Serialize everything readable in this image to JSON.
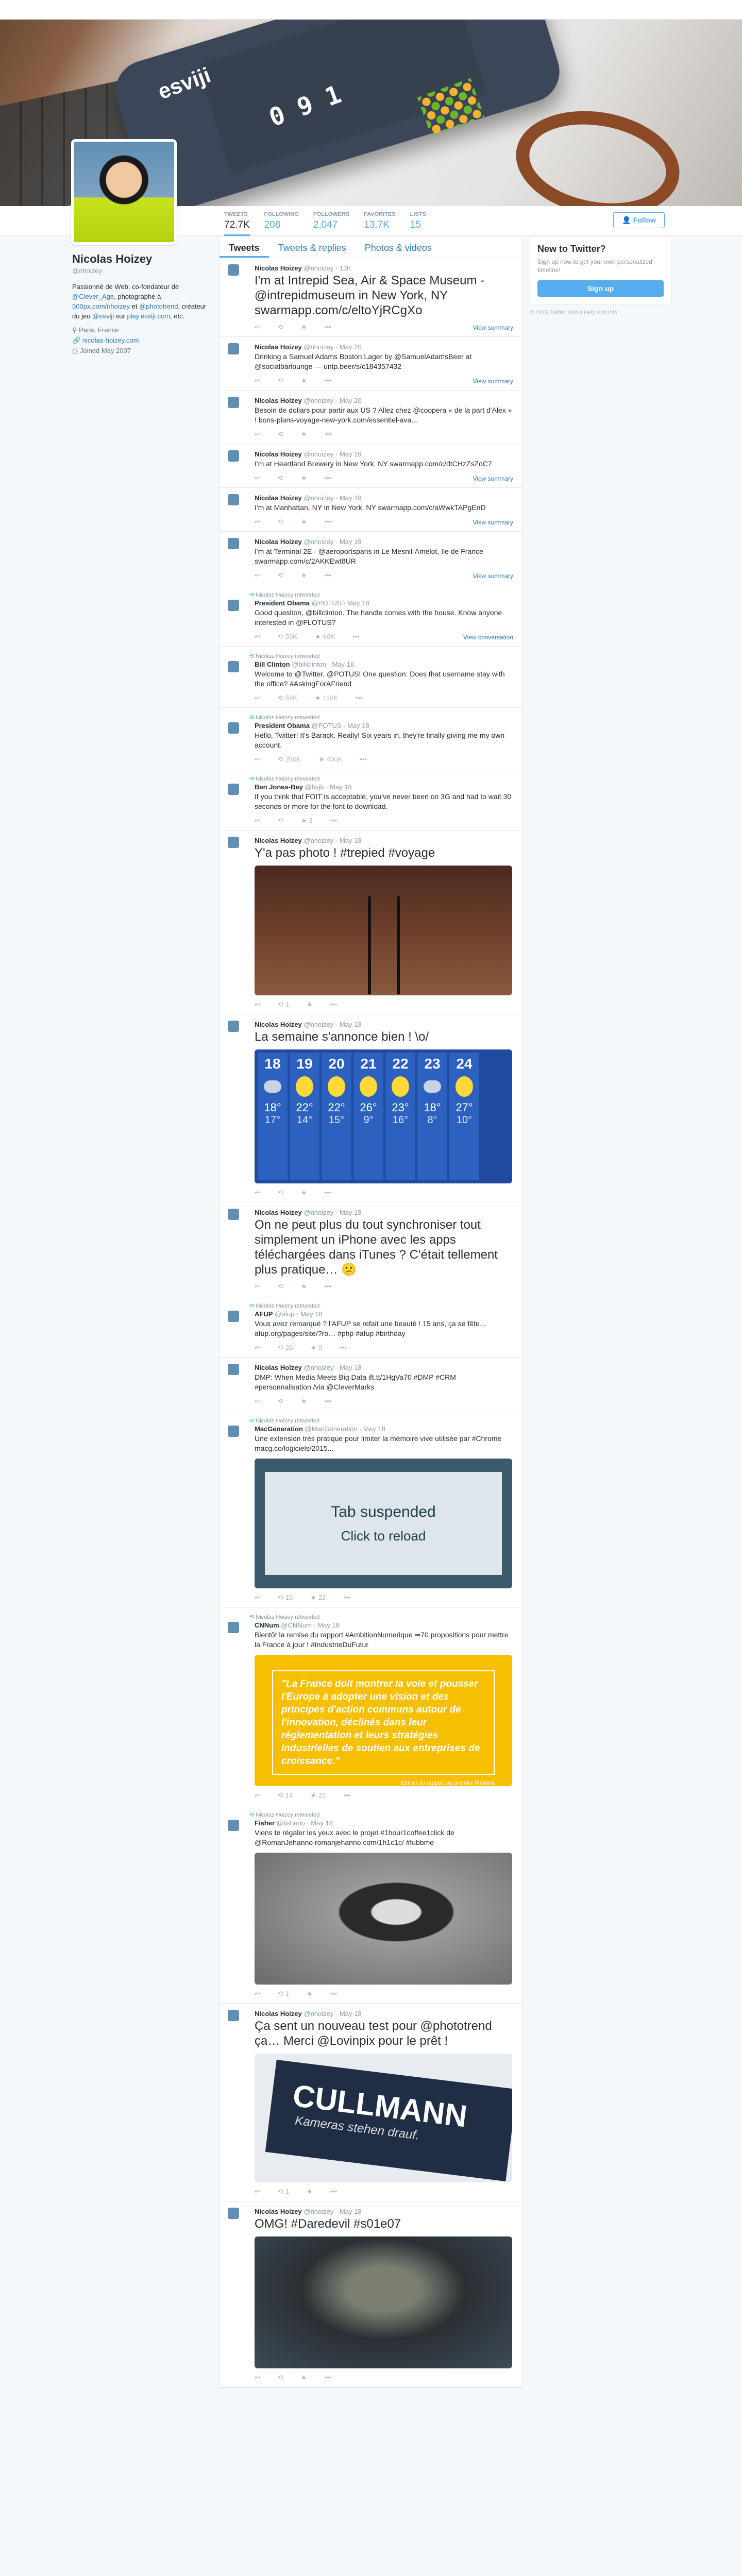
{
  "profile": {
    "name": "Nicolas Hoizey",
    "handle": "@nhoizey",
    "bio_parts": [
      "Passionné de Web, co-fondateur de ",
      "@Clever_Age",
      ", photographe à ",
      "500px.com/nhoizey",
      " et ",
      "@phototrend",
      ", créateur du jeu ",
      "@esviji",
      " sur ",
      "play.esviji.com",
      ", etc."
    ],
    "location": "Paris, France",
    "website": "nicolas-hoizey.com",
    "joined": "Joined May 2007"
  },
  "stats": [
    {
      "label": "Tweets",
      "value": "72.7K"
    },
    {
      "label": "Following",
      "value": "208"
    },
    {
      "label": "Followers",
      "value": "2,047"
    },
    {
      "label": "Favorites",
      "value": "13.7K"
    },
    {
      "label": "Lists",
      "value": "15"
    }
  ],
  "follow_label": "Follow",
  "tabs": [
    "Tweets",
    "Tweets & replies",
    "Photos & videos"
  ],
  "sidebar": {
    "title": "New to Twitter?",
    "text": "Sign up now to get your own personalized timeline!",
    "button": "Sign up",
    "footer": "© 2015 Twitter  About  Help  Ads info"
  },
  "tweets": [
    {
      "retweet": "",
      "name": "Nicolas Hoizey",
      "handle": "@nhoizey · 13h",
      "text": "I'm at Intrepid Sea, Air & Space Museum - @intrepidmuseum in New York, NY swarmapp.com/c/eltoYjRCgXo",
      "big": true,
      "summary": "View summary",
      "counts": [
        "",
        "",
        ""
      ]
    },
    {
      "retweet": "",
      "name": "Nicolas Hoizey",
      "handle": "@nhoizey · May 20",
      "text": "Drinking a Samuel Adams Boston Lager by @SamuelAdamsBeer at @socialbarlounge — untp.beer/s/c184357432",
      "big": false,
      "summary": "View summary",
      "counts": [
        "",
        "",
        ""
      ]
    },
    {
      "retweet": "",
      "name": "Nicolas Hoizey",
      "handle": "@nhoizey · May 20",
      "text": "Besoin de dollars pour partir aux US ? Allez chez @coopera « de la part d'Alex » ! bons-plans-voyage-new-york.com/essentiel-ava...",
      "big": false,
      "summary": "",
      "counts": [
        "",
        "",
        ""
      ]
    },
    {
      "retweet": "",
      "name": "Nicolas Hoizey",
      "handle": "@nhoizey · May 19",
      "text": "I'm at Heartland Brewery in New York, NY swarmapp.com/c/dtCHzZsZoC7",
      "big": false,
      "summary": "View summary",
      "counts": [
        "",
        "",
        ""
      ]
    },
    {
      "retweet": "",
      "name": "Nicolas Hoizey",
      "handle": "@nhoizey · May 19",
      "text": "I'm at Manhattan, NY in New York, NY swarmapp.com/c/aWwkTAPgEnD",
      "big": false,
      "summary": "View summary",
      "counts": [
        "",
        "",
        ""
      ]
    },
    {
      "retweet": "",
      "name": "Nicolas Hoizey",
      "handle": "@nhoizey · May 19",
      "text": "I'm at Terminal 2E - @aeroportsparis in Le Mesnil-Amelot, Ile de France swarmapp.com/c/2AKKEwt8UR",
      "big": false,
      "summary": "View summary",
      "counts": [
        "",
        "",
        ""
      ]
    },
    {
      "retweet": "Nicolas Hoizey retweeted",
      "name": "President Obama",
      "handle": "@POTUS · May 18",
      "text": "Good question, @billclinton. The handle comes with the house. Know anyone interested in @FLOTUS?",
      "big": false,
      "summary": "View conversation",
      "counts": [
        "",
        "59K",
        "60K"
      ]
    },
    {
      "retweet": "Nicolas Hoizey retweeted",
      "name": "Bill Clinton",
      "handle": "@billclinton · May 18",
      "text": "Welcome to @Twitter, @POTUS! One question: Does that username stay with the office? #AskingForAFriend",
      "big": false,
      "summary": "",
      "counts": [
        "",
        "59K",
        "110K"
      ]
    },
    {
      "retweet": "Nicolas Hoizey retweeted",
      "name": "President Obama",
      "handle": "@POTUS · May 18",
      "text": "Hello, Twitter! It's Barack. Really! Six years in, they're finally giving me my own account.",
      "big": false,
      "summary": "",
      "counts": [
        "",
        "260K",
        "400K"
      ]
    },
    {
      "retweet": "Nicolas Hoizey retweeted",
      "name": "Ben Jones-Bey",
      "handle": "@bvjb · May 18",
      "text": "If you think that FOIT is acceptable, you've never been on 3G and had to wait 30 seconds or more for the font to download.",
      "big": false,
      "summary": "",
      "counts": [
        "",
        "",
        "3"
      ]
    },
    {
      "retweet": "",
      "name": "Nicolas Hoizey",
      "handle": "@nhoizey · May 18",
      "text": "Y'a pas photo ! #trepied #voyage",
      "big": true,
      "media": "photo",
      "summary": "",
      "counts": [
        "",
        "1",
        ""
      ]
    },
    {
      "retweet": "",
      "name": "Nicolas Hoizey",
      "handle": "@nhoizey · May 18",
      "text": "La semaine s'annonce bien ! \\o/",
      "big": true,
      "media": "weather",
      "summary": "",
      "counts": [
        "",
        "",
        ""
      ]
    },
    {
      "retweet": "",
      "name": "Nicolas Hoizey",
      "handle": "@nhoizey · May 18",
      "text": "On ne peut plus du tout synchroniser tout simplement un iPhone avec les apps téléchargées dans iTunes ? C'était tellement plus pratique… 😕",
      "big": true,
      "summary": "",
      "counts": [
        "",
        "",
        ""
      ]
    },
    {
      "retweet": "Nicolas Hoizey retweeted",
      "name": "AFUP",
      "handle": "@afup · May 18",
      "text": "Vous avez remarqué ? l'AFUP se refait une beauté ! 15 ans, ça se fête… afup.org/pages/site/?ro… #php #afup #birthday",
      "big": false,
      "summary": "",
      "counts": [
        "",
        "26",
        "9"
      ]
    },
    {
      "retweet": "",
      "name": "Nicolas Hoizey",
      "handle": "@nhoizey · May 18",
      "text": "DMP: When Media Meets Big Data ift.tt/1HgVa70 #DMP #CRM #personnalisation /via @CleverMarks",
      "big": false,
      "summary": "",
      "counts": [
        "",
        "",
        ""
      ]
    },
    {
      "retweet": "Nicolas Hoizey retweeted",
      "name": "MacGeneration",
      "handle": "@MacGeneration · May 18",
      "text": "Une extension très pratique pour limiter la mémoire vive utilisée par #Chrome macg.co/logiciels/2015...",
      "big": false,
      "media": "tab",
      "summary": "",
      "counts": [
        "",
        "16",
        "22"
      ]
    },
    {
      "retweet": "Nicolas Hoizey retweeted",
      "name": "CNNum",
      "handle": "@CNNum · May 18",
      "text": "Bientôt la remise du rapport #AmbitionNumerique ⇒70 propositions pour mettre la France à jour ! #IndustrieDuFutur",
      "big": false,
      "media": "quote",
      "summary": "",
      "counts": [
        "",
        "14",
        "22"
      ]
    },
    {
      "retweet": "Nicolas Hoizey retweeted",
      "name": "Fisher",
      "handle": "@fisherio · May 18",
      "text": "Viens te régaler les yeux avec le projet #1hour1coffee1click de @RomanJehanno romanjehanno.com/1h1c1c/ #fubbme",
      "big": false,
      "media": "portrait",
      "summary": "",
      "counts": [
        "",
        "1",
        ""
      ]
    },
    {
      "retweet": "",
      "name": "Nicolas Hoizey",
      "handle": "@nhoizey · May 18",
      "text": "Ça sent un nouveau test pour @phototrend ça… Merci @Lovinpix pour le prêt !",
      "big": true,
      "media": "cullmann",
      "summary": "",
      "counts": [
        "",
        "1",
        ""
      ]
    },
    {
      "retweet": "",
      "name": "Nicolas Hoizey",
      "handle": "@nhoizey · May 18",
      "text": "OMG! #Daredevil #s01e07",
      "big": true,
      "media": "daredevil",
      "summary": "",
      "counts": [
        "",
        "",
        ""
      ]
    }
  ],
  "weather": [
    {
      "day": "18",
      "hi": "18°",
      "lo": "17°"
    },
    {
      "day": "19",
      "hi": "22°",
      "lo": "14°"
    },
    {
      "day": "20",
      "hi": "22°",
      "lo": "15°"
    },
    {
      "day": "21",
      "hi": "26°",
      "lo": "9°"
    },
    {
      "day": "22",
      "hi": "23°",
      "lo": "16°"
    },
    {
      "day": "23",
      "hi": "18°",
      "lo": "8°"
    },
    {
      "day": "24",
      "hi": "27°",
      "lo": "10°"
    }
  ],
  "media_text": {
    "tab_title": "Tab suspended",
    "tab_sub": "Click to reload",
    "quote": "\"La France doit montrer la voie et pousser l'Europe à adopter une vision et des principes d'action communs autour de l'innovation, déclinés dans leur réglementation et leurs stratégies industrielles de soutien aux entreprises de croissance.\"",
    "quote_sub": "Extrait du rapport au premier Ministre",
    "cullmann": "CULLMANN",
    "cullmann_tag": "Kameras stehen drauf."
  }
}
